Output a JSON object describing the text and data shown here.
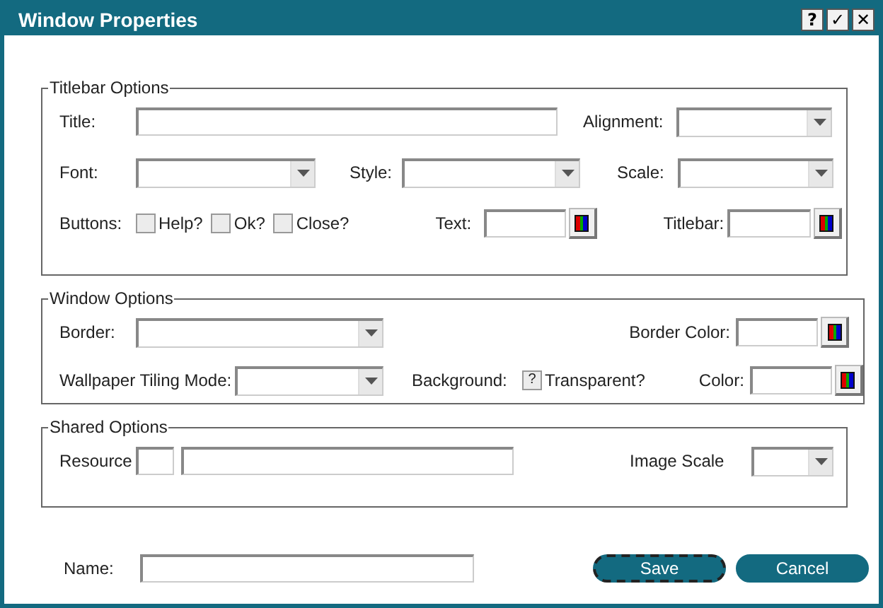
{
  "window": {
    "title": "Window Properties",
    "controls": [
      {
        "label": "?"
      },
      {
        "label": "✓"
      },
      {
        "label": "✕"
      }
    ]
  },
  "titlebar_options": {
    "legend": "Titlebar Options",
    "title": {
      "label": "Title:"
    },
    "alignment": {
      "label": "Alignment:"
    },
    "font": {
      "label": "Font:"
    },
    "style": {
      "label": "Style:"
    },
    "scale": {
      "label": "Scale:"
    },
    "buttons": {
      "label": "Buttons:",
      "checks": [
        {
          "label": "Help?",
          "checked": false
        },
        {
          "label": "Ok?",
          "checked": false
        },
        {
          "label": "Close?",
          "checked": false
        }
      ]
    },
    "text_color": {
      "label": "Text:"
    },
    "titlebar_color": {
      "label": "Titlebar:"
    }
  },
  "window_options": {
    "legend": "Window Options",
    "border": {
      "label": "Border:"
    },
    "border_color": {
      "label": "Border Color:"
    },
    "wallpaper": {
      "label": "Wallpaper Tiling Mode:"
    },
    "background": {
      "label": "Background:",
      "check": {
        "label": "Transparent?",
        "indeterminate": true,
        "mark": "?"
      }
    },
    "color": {
      "label": "Color:"
    }
  },
  "shared_options": {
    "legend": "Shared Options",
    "resource": {
      "label": "Resource"
    },
    "image_scale": {
      "label": "Image Scale"
    }
  },
  "name": {
    "label": "Name:"
  },
  "buttons": [
    {
      "label": "Save",
      "focused": true
    },
    {
      "label": "Cancel",
      "focused": false
    }
  ]
}
